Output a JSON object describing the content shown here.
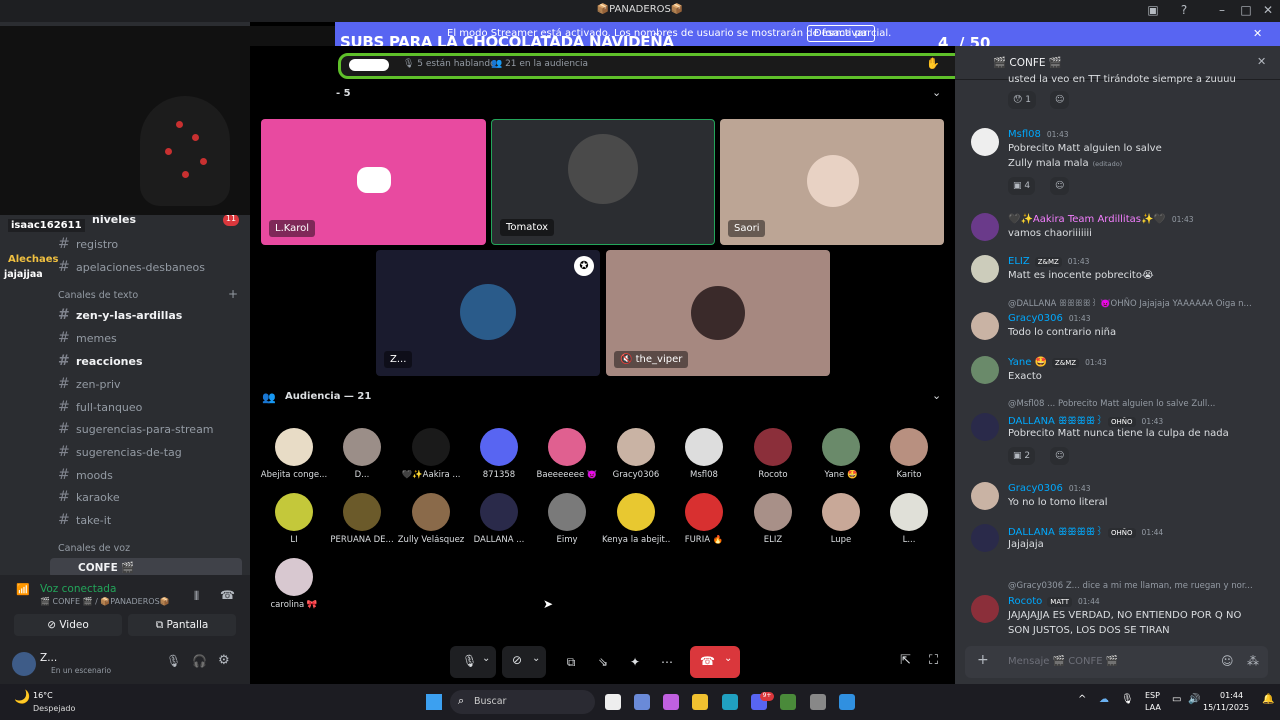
{
  "window": {
    "title": "📦PANADEROS📦"
  },
  "banner": {
    "text": "El modo Streamer está activado. Los nombres de usuario se mostrarán de forma parcial.",
    "button": "Desactivar"
  },
  "overlay": {
    "goal_title": "SUBS PARA LA CHOCOLATADA NAVIDEÑA",
    "goal_count": "4",
    "goal_total": "/ 50",
    "chat_user1": "isaac162611",
    "chat_user2": "Alechaes",
    "chat_msg2": "jajajjaa"
  },
  "stage": {
    "status_speaking": "5 están hablando",
    "status_audience": "21 en la audiencia",
    "speakers_header": "- 5",
    "speakers": [
      {
        "name": "L.Karol"
      },
      {
        "name": "Tomatox"
      },
      {
        "name": "Saori"
      },
      {
        "name": "Z..."
      },
      {
        "name": "the_viper"
      }
    ],
    "audience_header": "Audiencia — 21",
    "audience": [
      {
        "name": "Abejita conge...",
        "color": "#e8dcc6"
      },
      {
        "name": "D...",
        "color": "#9b8e88"
      },
      {
        "name": "🖤✨Aakira ...",
        "color": "#1a1a1a"
      },
      {
        "name": "871358",
        "color": "#5865f2"
      },
      {
        "name": "Baeeeeeee 👿",
        "color": "#e06090"
      },
      {
        "name": "Gracy0306",
        "color": "#c9b3a4"
      },
      {
        "name": "Msfl08",
        "color": "#ddd"
      },
      {
        "name": "Rocoto",
        "color": "#8b2f3a"
      },
      {
        "name": "Yane 🤩",
        "color": "#6a8a6a"
      },
      {
        "name": "Karito",
        "color": "#b89080"
      },
      {
        "name": "LI",
        "color": "#c4c83a"
      },
      {
        "name": "PERUANA DE...",
        "color": "#6b5a2a"
      },
      {
        "name": "Zully Velásquez",
        "color": "#8a6a4a"
      },
      {
        "name": "DALLANA ...",
        "color": "#2a2a4a"
      },
      {
        "name": "Eimy",
        "color": "#7a7a7a"
      },
      {
        "name": "Kenya la abejit...",
        "color": "#e8c830"
      },
      {
        "name": "FURIA 🔥",
        "color": "#d83030"
      },
      {
        "name": "ELIZ",
        "color": "#a89088"
      },
      {
        "name": "Lupe",
        "color": "#c8a898"
      },
      {
        "name": "L...",
        "color": "#e0e0d8"
      },
      {
        "name": "carolina 🎀",
        "color": "#d8c8d0"
      }
    ]
  },
  "sidebar": {
    "channel_niveles": "niveles",
    "niveles_badge": "11",
    "registro": "registro",
    "apelaciones": "apelaciones-desbaneos",
    "text_category": "Canales de texto",
    "text_channels": [
      "zen-y-las-ardillas",
      "memes",
      "reacciones",
      "zen-priv",
      "full-tanqueo",
      "sugerencias-para-stream",
      "sugerencias-de-tag",
      "moods",
      "karaoke",
      "take-it"
    ],
    "voice_category": "Canales de voz",
    "voice_channel": "CONFE 🎬",
    "voice_status": "Voz conectada",
    "voice_location": "🎬 CONFE 🎬 / 📦PANADEROS📦",
    "video_button": "Video",
    "screen_button": "Pantalla",
    "user_name": "Z...",
    "user_status": "En un escenario"
  },
  "chat": {
    "title": "🎬 CONFE 🎬",
    "top_text": "usted la veo en TT tirándote siempre a zuuuu",
    "messages": [
      {
        "name": "Msfl08",
        "time": "01:43",
        "lines": [
          "Pobrecito Matt alguien lo salve",
          "Zully mala mala"
        ],
        "edited": "(editado)",
        "react_count": "4"
      },
      {
        "name": "🖤✨Aakira Team Ardillitas✨🖤",
        "time": "01:43",
        "lines": [
          "vamos chaoriiiiiii"
        ]
      },
      {
        "name": "ELIZ",
        "tag": "Z&MZ",
        "time": "01:43",
        "lines": [
          "Matt es inocente pobrecito😭"
        ]
      },
      {
        "reply": "@DALLANA ꕥꕥꕥꕥ꒱ 👿OHÑO Jajajaja YAAAAAA Oiga n...",
        "name": "Gracy0306",
        "time": "01:43",
        "lines": [
          "Todo lo contrario niña"
        ]
      },
      {
        "name": "Yane 🤩",
        "tag": "Z&MZ",
        "time": "01:43",
        "lines": [
          "Exacto"
        ]
      },
      {
        "reply": "@Msfl08 ... Pobrecito Matt alguien lo salve Zull...",
        "name": "DALLANA ꕥꕥꕥꕥ꒱",
        "tag": "OHÑO",
        "time": "01:43",
        "lines": [
          "Pobrecito Matt nunca tiene la culpa de nada"
        ],
        "react_count": "2"
      },
      {
        "name": "Gracy0306",
        "time": "01:43",
        "lines": [
          "Yo no lo tomo literal"
        ]
      },
      {
        "name": "DALLANA ꕥꕥꕥꕥ꒱",
        "tag": "OHÑO",
        "time": "01:44",
        "lines": [
          "Jajajaja"
        ]
      },
      {
        "reply": "@Gracy0306 Z... dice a mi me llaman, me ruegan y nor...",
        "name": "Rocoto",
        "tag": "MATT",
        "time": "01:44",
        "lines": [
          "JAJAJAJJA ES VERDAD, NO ENTIENDO POR Q NO",
          "SON JUSTOS, LOS DOS SE TIRAN"
        ]
      }
    ],
    "first_react_count": "1",
    "input_placeholder": "Mensaje 🎬 CONFE 🎬"
  },
  "taskbar": {
    "weather_temp": "16°C",
    "weather_desc": "Despejado",
    "search": "Buscar",
    "lang1": "ESP",
    "lang2": "LAA",
    "time": "01:44",
    "date": "15/11/2025",
    "notif_badge": "9+"
  }
}
